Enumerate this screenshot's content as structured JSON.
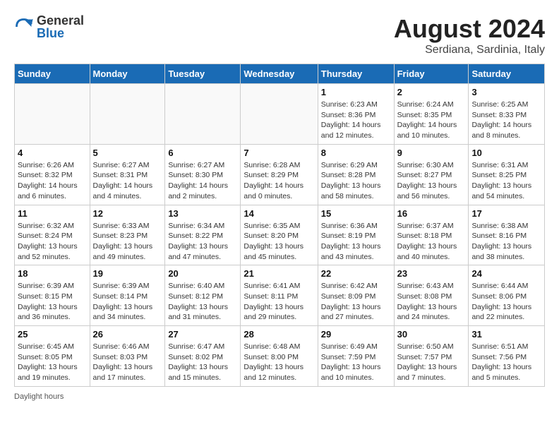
{
  "header": {
    "logo_general": "General",
    "logo_blue": "Blue",
    "month_year": "August 2024",
    "location": "Serdiana, Sardinia, Italy"
  },
  "days_of_week": [
    "Sunday",
    "Monday",
    "Tuesday",
    "Wednesday",
    "Thursday",
    "Friday",
    "Saturday"
  ],
  "weeks": [
    [
      {
        "day": "",
        "info": ""
      },
      {
        "day": "",
        "info": ""
      },
      {
        "day": "",
        "info": ""
      },
      {
        "day": "",
        "info": ""
      },
      {
        "day": "1",
        "info": "Sunrise: 6:23 AM\nSunset: 8:36 PM\nDaylight: 14 hours and 12 minutes."
      },
      {
        "day": "2",
        "info": "Sunrise: 6:24 AM\nSunset: 8:35 PM\nDaylight: 14 hours and 10 minutes."
      },
      {
        "day": "3",
        "info": "Sunrise: 6:25 AM\nSunset: 8:33 PM\nDaylight: 14 hours and 8 minutes."
      }
    ],
    [
      {
        "day": "4",
        "info": "Sunrise: 6:26 AM\nSunset: 8:32 PM\nDaylight: 14 hours and 6 minutes."
      },
      {
        "day": "5",
        "info": "Sunrise: 6:27 AM\nSunset: 8:31 PM\nDaylight: 14 hours and 4 minutes."
      },
      {
        "day": "6",
        "info": "Sunrise: 6:27 AM\nSunset: 8:30 PM\nDaylight: 14 hours and 2 minutes."
      },
      {
        "day": "7",
        "info": "Sunrise: 6:28 AM\nSunset: 8:29 PM\nDaylight: 14 hours and 0 minutes."
      },
      {
        "day": "8",
        "info": "Sunrise: 6:29 AM\nSunset: 8:28 PM\nDaylight: 13 hours and 58 minutes."
      },
      {
        "day": "9",
        "info": "Sunrise: 6:30 AM\nSunset: 8:27 PM\nDaylight: 13 hours and 56 minutes."
      },
      {
        "day": "10",
        "info": "Sunrise: 6:31 AM\nSunset: 8:25 PM\nDaylight: 13 hours and 54 minutes."
      }
    ],
    [
      {
        "day": "11",
        "info": "Sunrise: 6:32 AM\nSunset: 8:24 PM\nDaylight: 13 hours and 52 minutes."
      },
      {
        "day": "12",
        "info": "Sunrise: 6:33 AM\nSunset: 8:23 PM\nDaylight: 13 hours and 49 minutes."
      },
      {
        "day": "13",
        "info": "Sunrise: 6:34 AM\nSunset: 8:22 PM\nDaylight: 13 hours and 47 minutes."
      },
      {
        "day": "14",
        "info": "Sunrise: 6:35 AM\nSunset: 8:20 PM\nDaylight: 13 hours and 45 minutes."
      },
      {
        "day": "15",
        "info": "Sunrise: 6:36 AM\nSunset: 8:19 PM\nDaylight: 13 hours and 43 minutes."
      },
      {
        "day": "16",
        "info": "Sunrise: 6:37 AM\nSunset: 8:18 PM\nDaylight: 13 hours and 40 minutes."
      },
      {
        "day": "17",
        "info": "Sunrise: 6:38 AM\nSunset: 8:16 PM\nDaylight: 13 hours and 38 minutes."
      }
    ],
    [
      {
        "day": "18",
        "info": "Sunrise: 6:39 AM\nSunset: 8:15 PM\nDaylight: 13 hours and 36 minutes."
      },
      {
        "day": "19",
        "info": "Sunrise: 6:39 AM\nSunset: 8:14 PM\nDaylight: 13 hours and 34 minutes."
      },
      {
        "day": "20",
        "info": "Sunrise: 6:40 AM\nSunset: 8:12 PM\nDaylight: 13 hours and 31 minutes."
      },
      {
        "day": "21",
        "info": "Sunrise: 6:41 AM\nSunset: 8:11 PM\nDaylight: 13 hours and 29 minutes."
      },
      {
        "day": "22",
        "info": "Sunrise: 6:42 AM\nSunset: 8:09 PM\nDaylight: 13 hours and 27 minutes."
      },
      {
        "day": "23",
        "info": "Sunrise: 6:43 AM\nSunset: 8:08 PM\nDaylight: 13 hours and 24 minutes."
      },
      {
        "day": "24",
        "info": "Sunrise: 6:44 AM\nSunset: 8:06 PM\nDaylight: 13 hours and 22 minutes."
      }
    ],
    [
      {
        "day": "25",
        "info": "Sunrise: 6:45 AM\nSunset: 8:05 PM\nDaylight: 13 hours and 19 minutes."
      },
      {
        "day": "26",
        "info": "Sunrise: 6:46 AM\nSunset: 8:03 PM\nDaylight: 13 hours and 17 minutes."
      },
      {
        "day": "27",
        "info": "Sunrise: 6:47 AM\nSunset: 8:02 PM\nDaylight: 13 hours and 15 minutes."
      },
      {
        "day": "28",
        "info": "Sunrise: 6:48 AM\nSunset: 8:00 PM\nDaylight: 13 hours and 12 minutes."
      },
      {
        "day": "29",
        "info": "Sunrise: 6:49 AM\nSunset: 7:59 PM\nDaylight: 13 hours and 10 minutes."
      },
      {
        "day": "30",
        "info": "Sunrise: 6:50 AM\nSunset: 7:57 PM\nDaylight: 13 hours and 7 minutes."
      },
      {
        "day": "31",
        "info": "Sunrise: 6:51 AM\nSunset: 7:56 PM\nDaylight: 13 hours and 5 minutes."
      }
    ]
  ],
  "footer": {
    "daylight_hours": "Daylight hours"
  }
}
